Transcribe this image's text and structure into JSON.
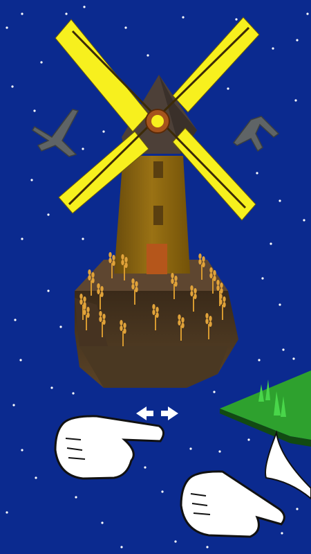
{
  "scene": {
    "background_color": "#0b2a8f",
    "description_icons": {
      "windmill": "windmill-icon",
      "bird_left": "bird-icon",
      "bird_right": "bird-icon",
      "grass_island": "grass-island-icon",
      "hint_left": "pointing-hand-icon",
      "hint_right": "pointing-hand-icon",
      "swipe_arrows": "left-right-arrows-icon"
    },
    "colors": {
      "sails": "#f7f01e",
      "tower": "#8a6410",
      "roof": "#4d4038",
      "island": "#5a4327",
      "wheat": "#e1a33a",
      "grass": "#2ea12e",
      "bird": "#5f6466",
      "hand": "#ffffff",
      "door": "#b5561b"
    }
  }
}
